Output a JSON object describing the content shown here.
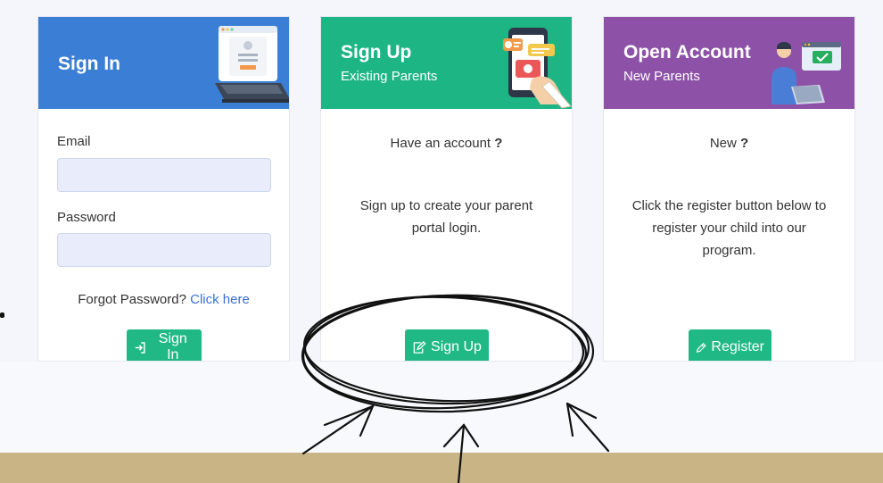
{
  "signin": {
    "title": "Sign In",
    "email_label": "Email",
    "email_value": "",
    "password_label": "Password",
    "password_value": "",
    "forgot_text": "Forgot Password?",
    "forgot_link": "Click here",
    "button_label": "Sign In",
    "header_color": "#3a7fd5"
  },
  "signup": {
    "title": "Sign Up",
    "subtitle": "Existing Parents",
    "question": "Have an account",
    "question_mark": "?",
    "desc_line1": "Sign up to create your parent",
    "desc_line2": "portal login.",
    "button_label": "Sign Up",
    "header_color": "#1eb585"
  },
  "open_account": {
    "title": "Open Account",
    "subtitle": "New Parents",
    "question": "New",
    "question_mark": "?",
    "desc_line1": "Click the register button below to",
    "desc_line2": "register your child into our",
    "desc_line3": "program.",
    "button_label": "Register",
    "header_color": "#8d52a8"
  },
  "colors": {
    "button": "#20b985",
    "link": "#3a70d4",
    "band": "#c9b486"
  }
}
